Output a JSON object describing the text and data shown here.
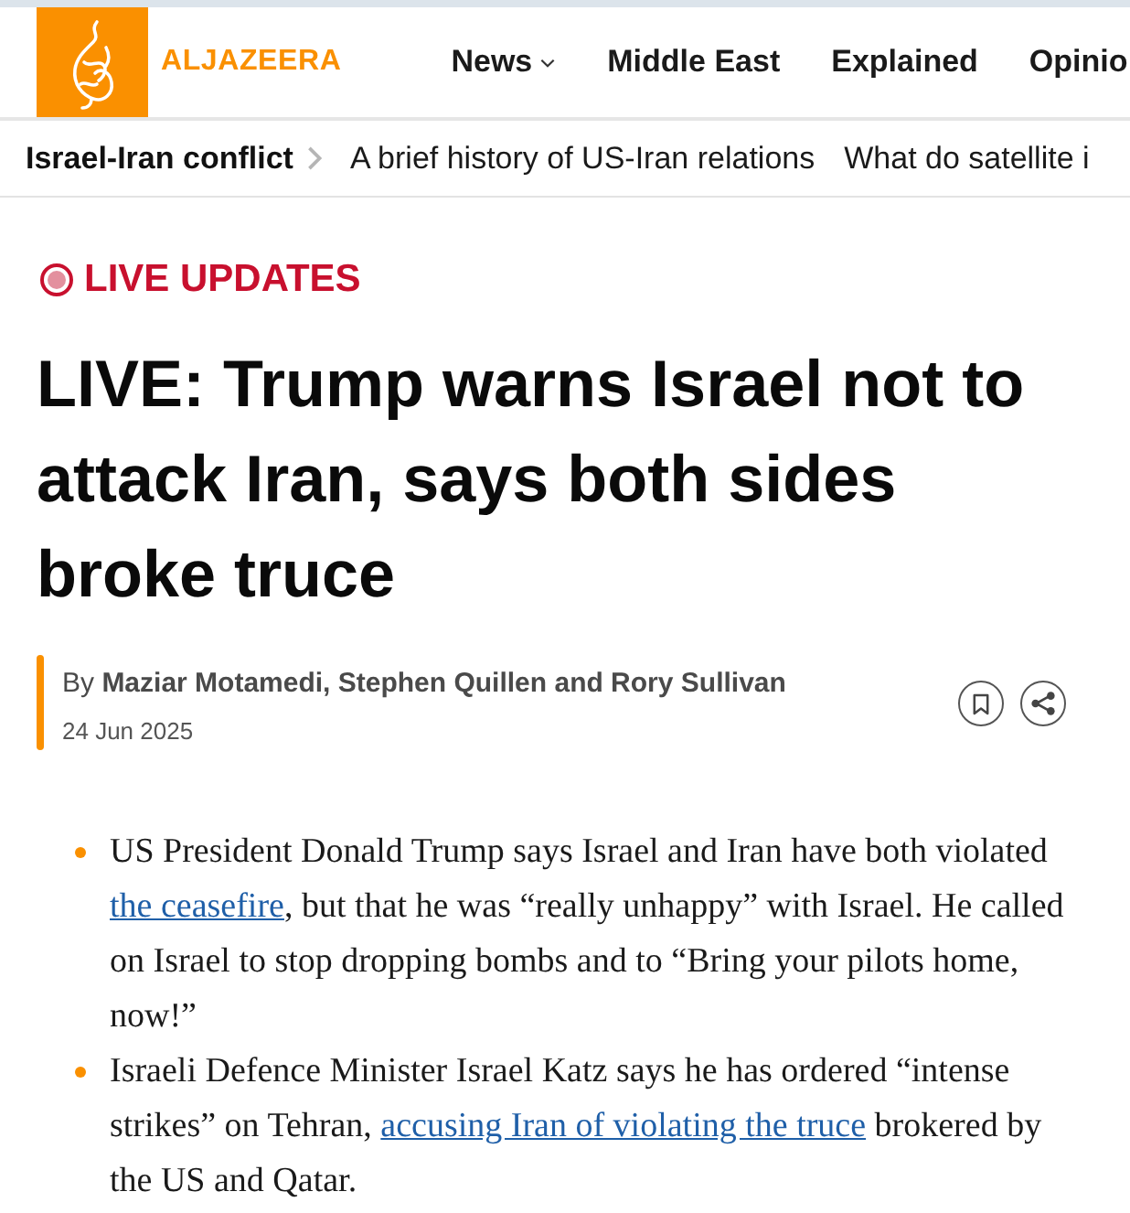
{
  "header": {
    "brand": "ALJAZEERA",
    "nav": [
      {
        "label": "News",
        "kind": "dropdown"
      },
      {
        "label": "Middle East",
        "kind": "link"
      },
      {
        "label": "Explained",
        "kind": "link"
      },
      {
        "label": "Opinio",
        "kind": "link"
      }
    ]
  },
  "topic_bar": {
    "topic": "Israel-Iran conflict",
    "links": [
      "A brief history of US-Iran relations",
      "What do satellite i"
    ]
  },
  "article": {
    "badge": "LIVE UPDATES",
    "title": "LIVE: Trump warns Israel not to attack Iran, says both sides broke truce",
    "byline": "By **Maziar Motamedi, Stephen Quillen and Rory Sullivan**",
    "date": "24 Jun 2025"
  },
  "summary": [
    [
      {
        "kind": "text",
        "text": "US President Donald Trump says Israel and Iran have both violated "
      },
      {
        "kind": "link",
        "text": "the ceasefire"
      },
      {
        "kind": "text",
        "text": ", but that he was “really unhappy” with Israel. He called on Israel to stop dropping bombs and to “Bring your pilots home, now!”"
      }
    ],
    [
      {
        "kind": "text",
        "text": "Israeli Defence Minister Israel Katz says he has ordered “intense strikes” on Tehran, "
      },
      {
        "kind": "link",
        "text": "accusing Iran of violating the truce"
      },
      {
        "kind": "text",
        "text": " brokered by the US and Qatar."
      }
    ]
  ]
}
